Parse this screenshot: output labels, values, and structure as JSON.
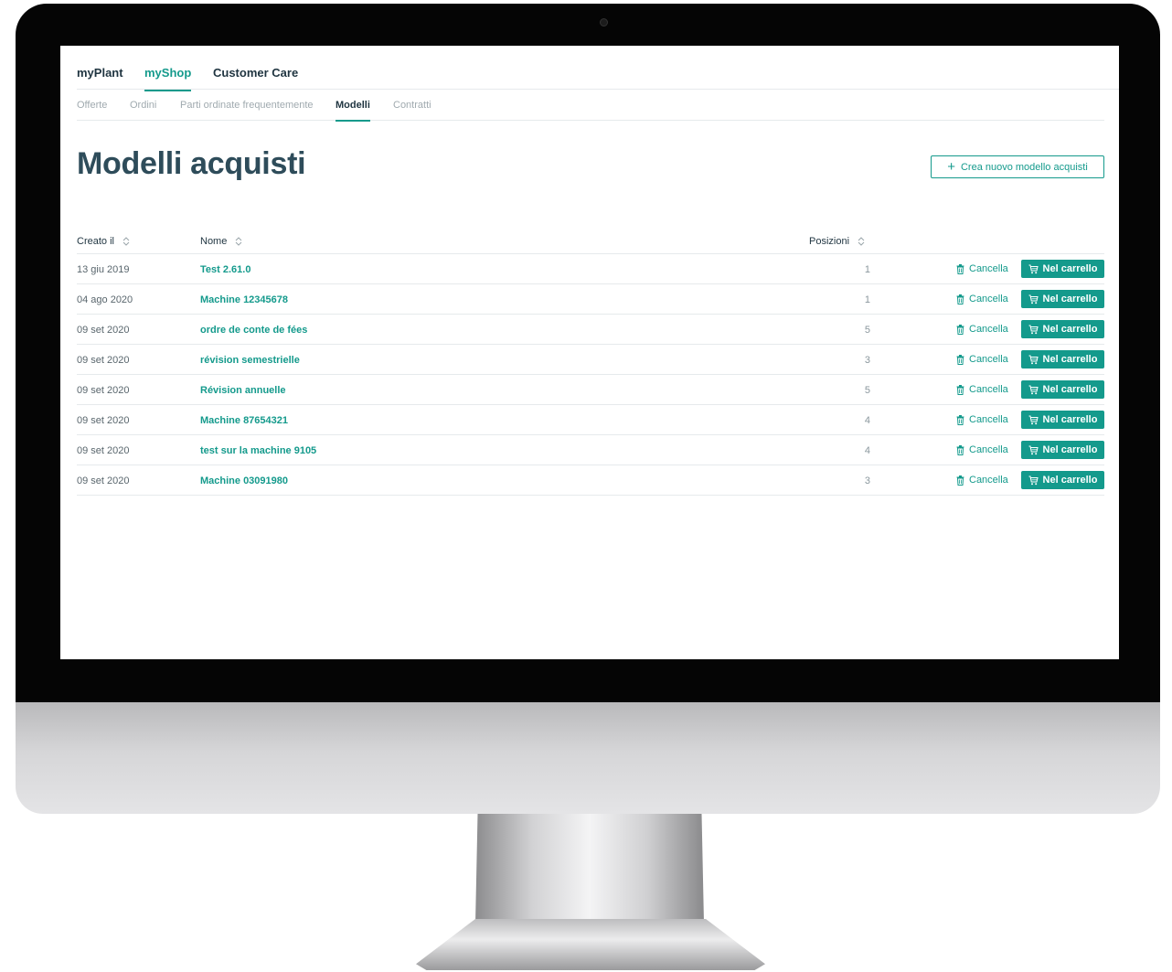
{
  "topnav": {
    "items": [
      {
        "label": "myPlant",
        "active": false
      },
      {
        "label": "myShop",
        "active": true
      },
      {
        "label": "Customer Care",
        "active": false
      }
    ]
  },
  "subnav": {
    "items": [
      {
        "label": "Offerte",
        "active": false
      },
      {
        "label": "Ordini",
        "active": false
      },
      {
        "label": "Parti ordinate frequentemente",
        "active": false
      },
      {
        "label": "Modelli",
        "active": true
      },
      {
        "label": "Contratti",
        "active": false
      }
    ]
  },
  "page": {
    "title": "Modelli acquisti",
    "create_button_label": "Crea nuovo modello acquisti"
  },
  "table": {
    "columns": {
      "created": "Creato il",
      "name": "Nome",
      "positions": "Posizioni"
    },
    "delete_label": "Cancella",
    "cart_label": "Nel carrello",
    "rows": [
      {
        "created": "13 giu 2019",
        "name": "Test 2.61.0",
        "positions": "1"
      },
      {
        "created": "04 ago 2020",
        "name": "Machine 12345678",
        "positions": "1"
      },
      {
        "created": "09 set 2020",
        "name": "ordre de conte de fées",
        "positions": "5"
      },
      {
        "created": "09 set 2020",
        "name": "révision semestrielle",
        "positions": "3"
      },
      {
        "created": "09 set 2020",
        "name": "Révision annuelle",
        "positions": "5"
      },
      {
        "created": "09 set 2020",
        "name": "Machine 87654321",
        "positions": "4"
      },
      {
        "created": "09 set 2020",
        "name": "test sur la machine 9105",
        "positions": "4"
      },
      {
        "created": "09 set 2020",
        "name": "Machine 03091980",
        "positions": "3"
      }
    ]
  },
  "colors": {
    "accent": "#149a8c",
    "title": "#2e4c5a",
    "border": "#e6eaec"
  },
  "icons": {
    "sort": "sort-icon",
    "trash": "trash-icon",
    "cart": "cart-icon",
    "plus": "plus-icon"
  }
}
